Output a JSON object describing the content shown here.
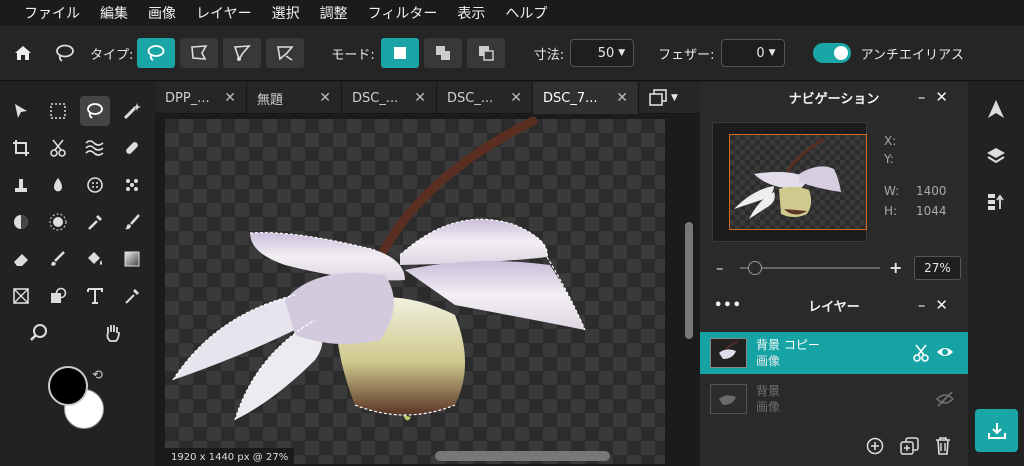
{
  "menu": [
    "ファイル",
    "編集",
    "画像",
    "レイヤー",
    "選択",
    "調整",
    "フィルター",
    "表示",
    "ヘルプ"
  ],
  "options": {
    "type_label": "タイプ:",
    "mode_label": "モード:",
    "size_label": "寸法:",
    "size_value": "50",
    "feather_label": "フェザー:",
    "feather_value": "0",
    "antialias_label": "アンチエイリアス"
  },
  "tabs": [
    {
      "label": "DPP_..."
    },
    {
      "label": "無題"
    },
    {
      "label": "DSC_..."
    },
    {
      "label": "DSC_..."
    },
    {
      "label": "DSC_7..."
    }
  ],
  "canvas": {
    "status": "1920 x 1440 px @ 27%"
  },
  "navigator": {
    "title": "ナビゲーション",
    "x_label": "X:",
    "y_label": "Y:",
    "w_label": "W:",
    "w_value": "1400",
    "h_label": "H:",
    "h_value": "1044",
    "zoom": "27%"
  },
  "layers": {
    "title": "レイヤー",
    "items": [
      {
        "name": "背景 コピー",
        "type": "画像"
      },
      {
        "name": "背景",
        "type": "画像"
      }
    ]
  },
  "colors": {
    "accent": "#1aa6a6",
    "foreground": "#000000",
    "background": "#ffffff"
  }
}
